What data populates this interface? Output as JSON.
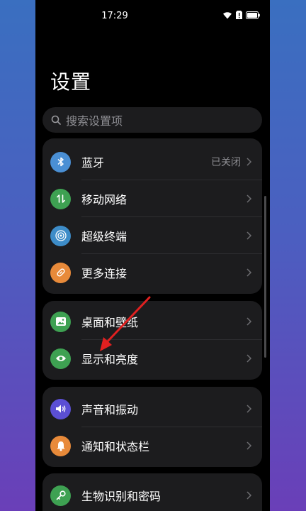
{
  "status_bar": {
    "time": "17:29"
  },
  "page": {
    "title": "设置"
  },
  "search": {
    "placeholder": "搜索设置项"
  },
  "sections": [
    {
      "items": [
        {
          "label": "蓝牙",
          "value": "已关闭",
          "icon": "bluetooth-icon",
          "color": "#4a8fd4"
        },
        {
          "label": "移动网络",
          "value": "",
          "icon": "mobile-network-icon",
          "color": "#3ea152"
        },
        {
          "label": "超级终端",
          "value": "",
          "icon": "super-device-icon",
          "color": "#3d8cc8"
        },
        {
          "label": "更多连接",
          "value": "",
          "icon": "link-icon",
          "color": "#e88a3a"
        }
      ]
    },
    {
      "items": [
        {
          "label": "桌面和壁纸",
          "value": "",
          "icon": "wallpaper-icon",
          "color": "#3ea152"
        },
        {
          "label": "显示和亮度",
          "value": "",
          "icon": "eye-icon",
          "color": "#3ea152"
        }
      ]
    },
    {
      "items": [
        {
          "label": "声音和振动",
          "value": "",
          "icon": "sound-icon",
          "color": "#5b4fd4"
        },
        {
          "label": "通知和状态栏",
          "value": "",
          "icon": "bell-icon",
          "color": "#e88a3a"
        }
      ]
    },
    {
      "items": [
        {
          "label": "生物识别和密码",
          "value": "",
          "icon": "key-icon",
          "color": "#3ea152"
        }
      ]
    }
  ],
  "annotation": {
    "color": "#e02020"
  }
}
